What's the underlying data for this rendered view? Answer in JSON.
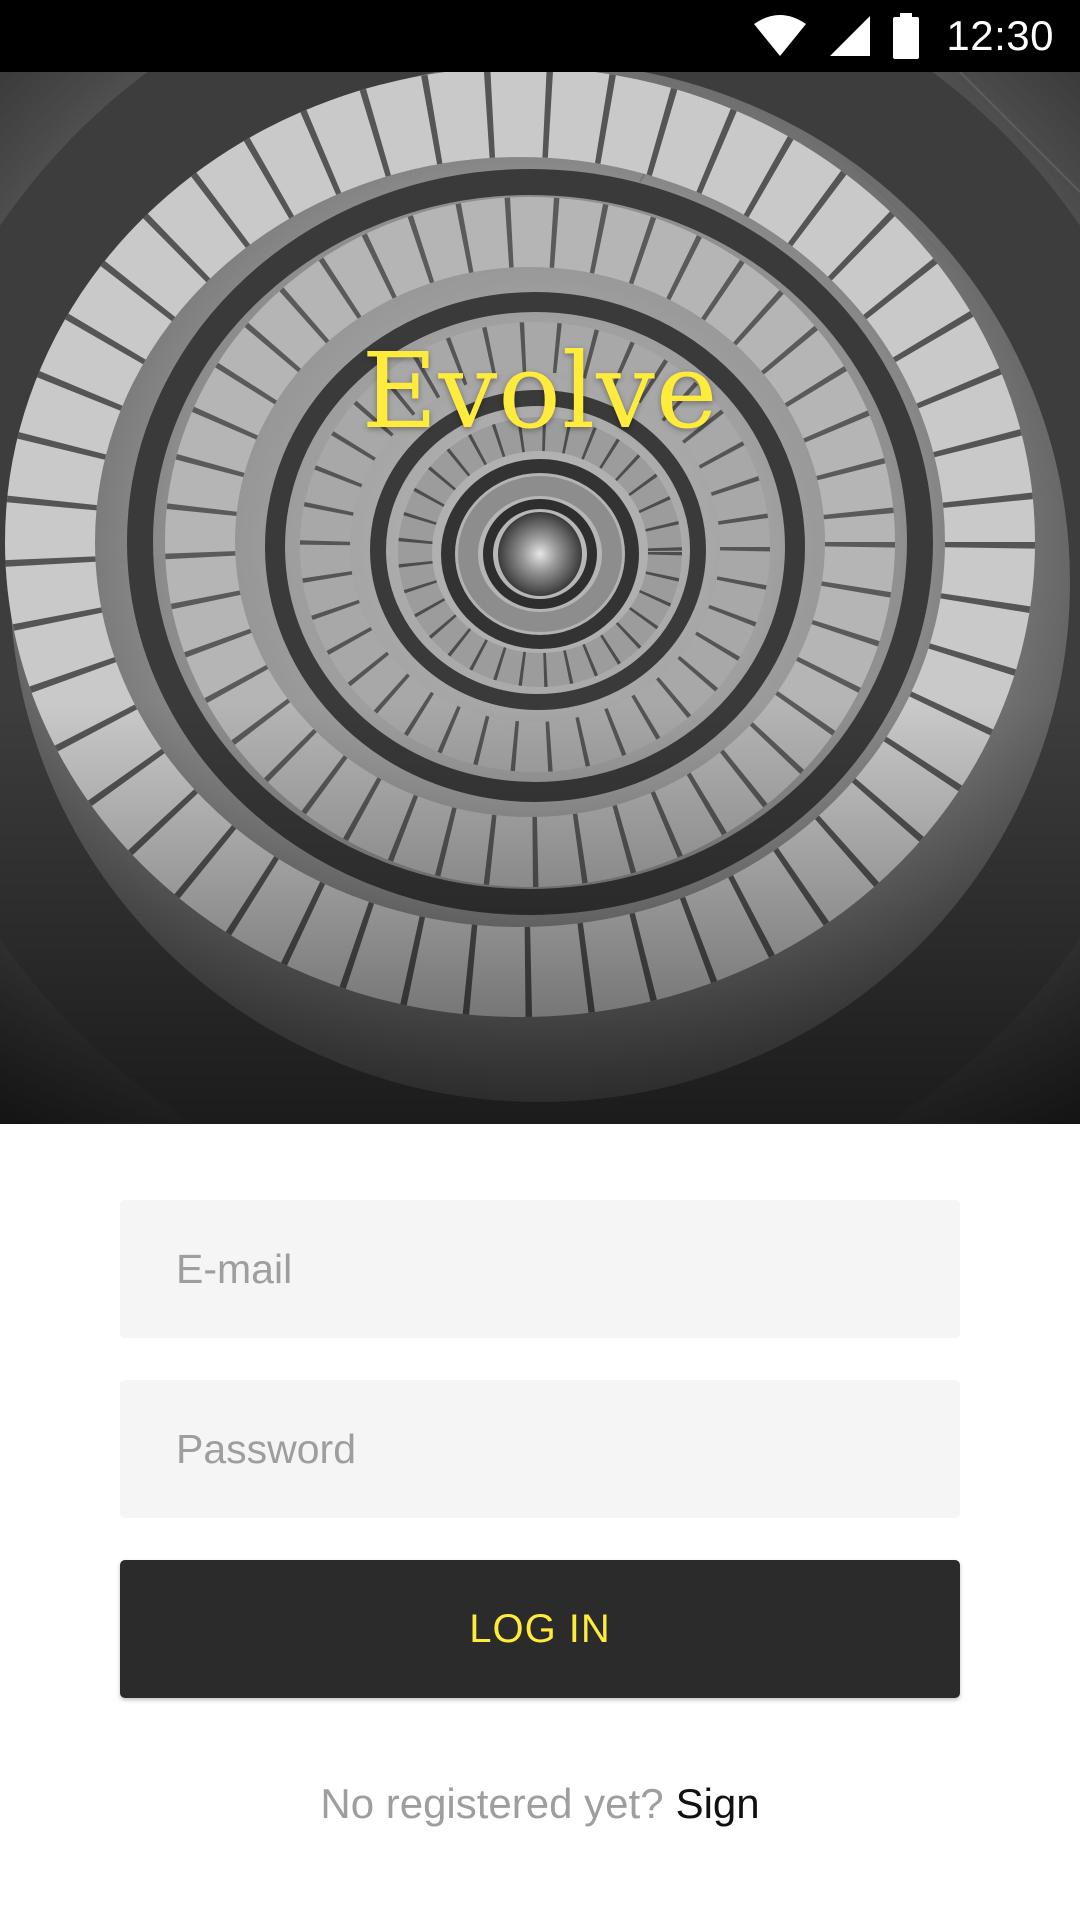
{
  "status_bar": {
    "time": "12:30",
    "icons": [
      "wifi-icon",
      "cell-signal-icon",
      "battery-icon"
    ]
  },
  "hero": {
    "image": "spiral-staircase-photo",
    "title": "Evolve",
    "title_color": "#ffeb3b"
  },
  "login_form": {
    "email_placeholder": "E-mail",
    "email_value": "",
    "password_placeholder": "Password",
    "password_value": "",
    "login_label": "LOG IN"
  },
  "register": {
    "prompt": "No registered yet?",
    "link_label": "Sign"
  },
  "colors": {
    "accent": "#ffeb3b",
    "button_bg": "#2b2b2b",
    "field_bg": "#f5f5f5",
    "status_bar_bg": "#000000"
  }
}
